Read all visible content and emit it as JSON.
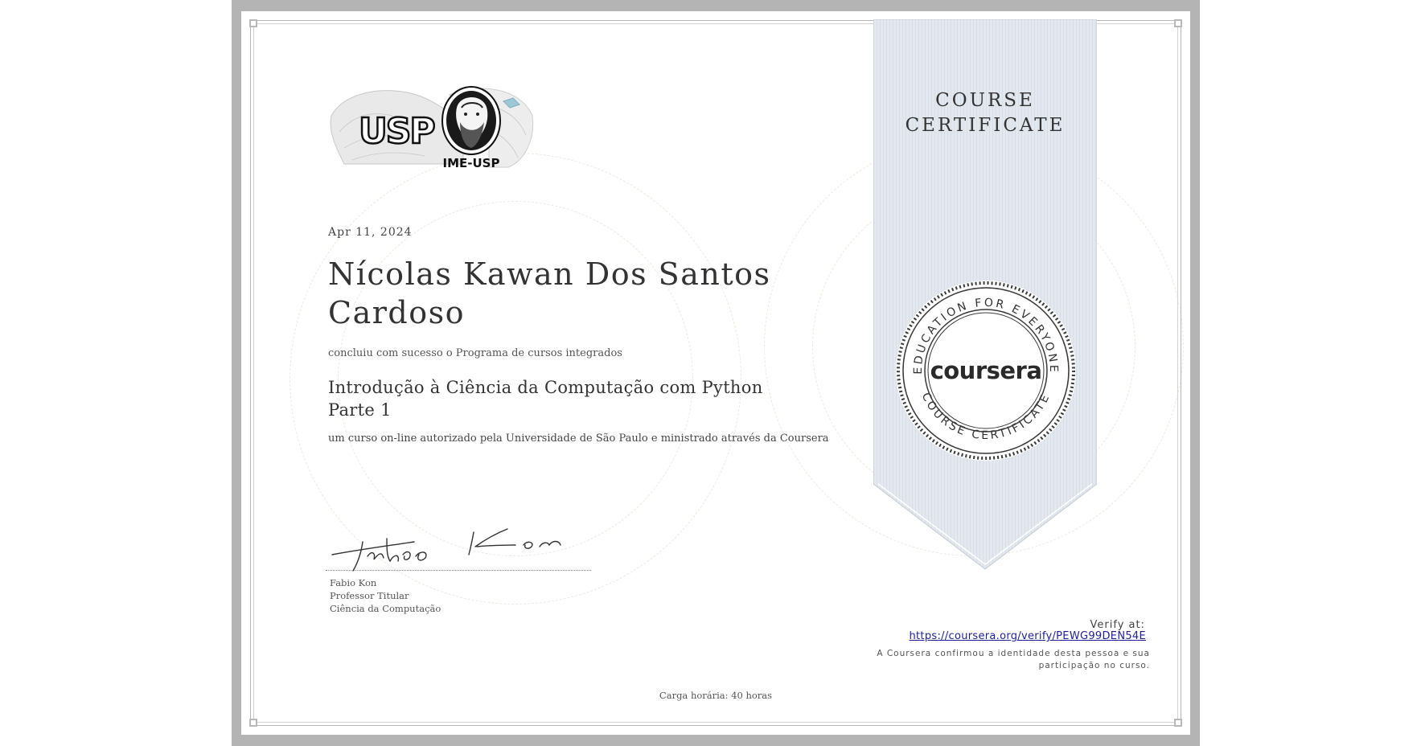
{
  "logo": {
    "university_mark": "USP",
    "institute": "IME-USP"
  },
  "certificate": {
    "date": "Apr 11, 2024",
    "recipient_name": "Nícolas Kawan Dos Santos Cardoso",
    "completion_text": "concluiu com sucesso o Programa de cursos integrados",
    "course_title": "Introdução à Ciência da Computação com Python Parte 1",
    "authorization_text": "um curso on-line autorizado pela Universidade de São Paulo e ministrado através da Coursera",
    "workload": "Carga horária: 40 horas"
  },
  "signer": {
    "signature_text": "Fabio Kon",
    "name": "Fabio Kon",
    "title": "Professor Titular",
    "department": "Ciência da Computação"
  },
  "ribbon": {
    "title_line1": "COURSE",
    "title_line2": "CERTIFICATE",
    "seal_brand": "coursera",
    "seal_ring_top": "EDUCATION FOR EVERYONE",
    "seal_ring_bottom": "COURSE CERTIFICATE"
  },
  "verify": {
    "label": "Verify at:",
    "url": "https://coursera.org/verify/PEWG99DEN54E",
    "note": "A Coursera confirmou a identidade desta pessoa e sua participação no curso."
  },
  "colors": {
    "frame": "#b4b4b4",
    "ribbon": "#e3e8ef",
    "link": "#1f1f99",
    "text": "#333333"
  }
}
